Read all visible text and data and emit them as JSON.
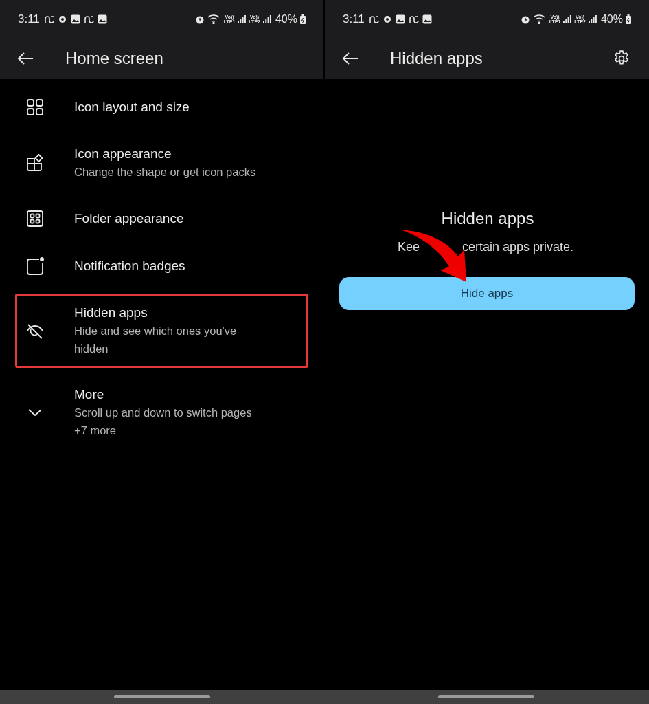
{
  "panels": [
    {
      "status_bar": {
        "time": "3:11",
        "sim1": {
          "top": "Vo))",
          "bottom": "LTE1"
        },
        "sim2": {
          "top": "Vo))",
          "bottom": "LTE2"
        },
        "battery": "40%"
      },
      "title": "Home screen",
      "items": [
        {
          "kind": "grid",
          "title": "Icon layout and size",
          "highlighted": false
        },
        {
          "kind": "shapes",
          "title": "Icon appearance",
          "subtitle": "Change the shape or get icon packs",
          "highlighted": false
        },
        {
          "kind": "folder",
          "title": "Folder appearance",
          "highlighted": false
        },
        {
          "kind": "badge",
          "title": "Notification badges",
          "highlighted": false
        },
        {
          "kind": "eye-off",
          "title": "Hidden apps",
          "subtitle": "Hide and see which ones you've hidden",
          "highlighted": true
        },
        {
          "kind": "chevron",
          "title": "More",
          "subtitle": "Scroll up and down to switch pages",
          "extra": "+7 more",
          "highlighted": false
        }
      ]
    },
    {
      "status_bar": {
        "time": "3:11",
        "sim1": {
          "top": "Vo))",
          "bottom": "LTE1"
        },
        "sim2": {
          "top": "Vo))",
          "bottom": "LTE2"
        },
        "battery": "40%"
      },
      "title": "Hidden apps",
      "actions": [
        {
          "kind": "settings"
        }
      ],
      "empty_state": {
        "heading": "Hidden apps",
        "text_parts": [
          "Kee",
          "certain apps private."
        ],
        "button": "Hide apps"
      }
    }
  ]
}
